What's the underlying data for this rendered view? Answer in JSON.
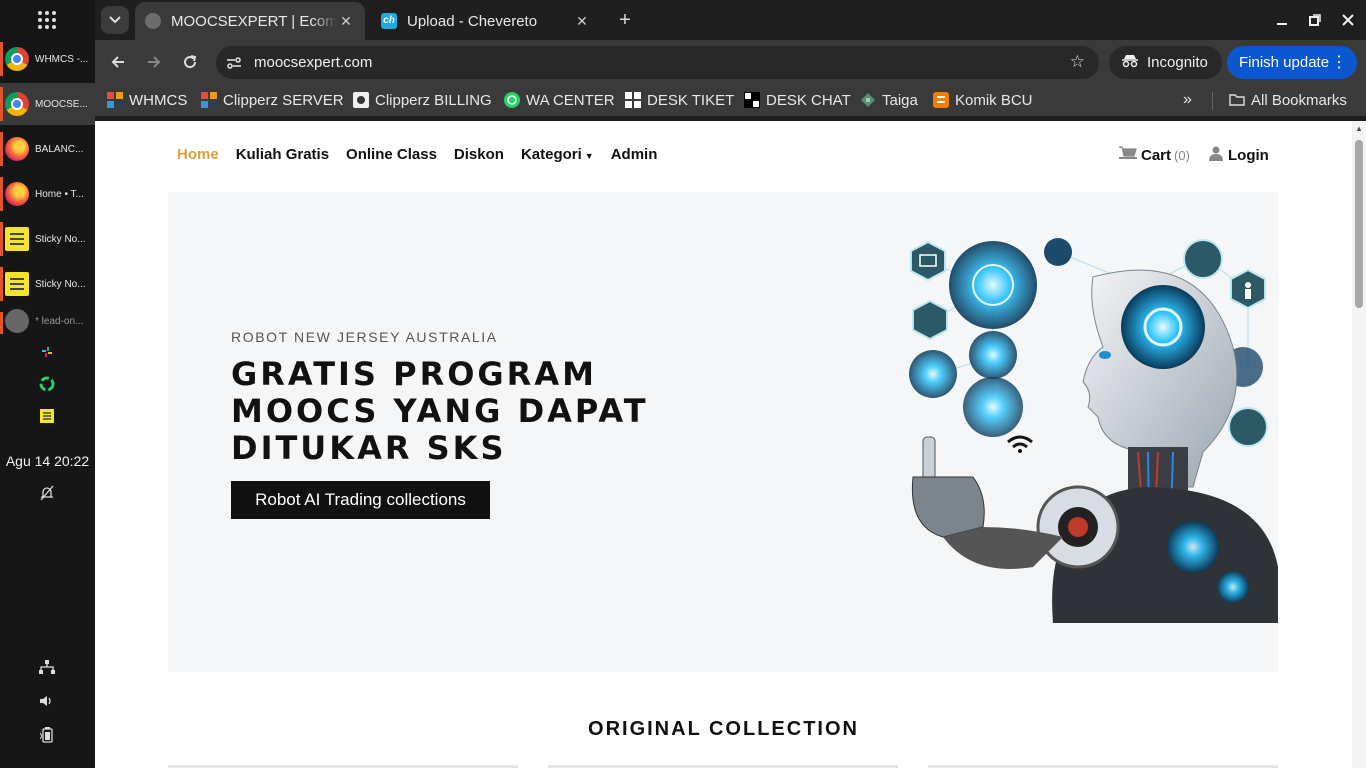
{
  "taskbar": {
    "items": [
      {
        "label": "WHMCS -...",
        "icon": "chrome-icon",
        "active": false
      },
      {
        "label": "MOOCSE...",
        "icon": "chrome-icon",
        "active": true
      },
      {
        "label": "BALANC...",
        "icon": "firefox-icon",
        "active": false
      },
      {
        "label": "Home • T...",
        "icon": "firefox-icon",
        "active": false
      },
      {
        "label": "Sticky No...",
        "icon": "sticky-notes-icon",
        "active": false
      },
      {
        "label": "Sticky No...",
        "icon": "sticky-notes-icon",
        "active": false
      },
      {
        "label": "* lead-on...",
        "icon": "app-icon",
        "active": false
      }
    ],
    "clock": "Agu 14  20:22"
  },
  "browser": {
    "tabs": [
      {
        "title": "MOOCSEXPERT | Ecomm",
        "icon": "globe-icon",
        "active": true
      },
      {
        "title": "Upload - Chevereto",
        "icon": "chevereto-icon",
        "active": false
      }
    ],
    "url": "moocsexpert.com",
    "incognito_label": "Incognito",
    "finish_update_label": "Finish update",
    "bookmarks": [
      {
        "label": "WHMCS",
        "icon": "whmcs-icon"
      },
      {
        "label": "Clipperz SERVER",
        "icon": "whmcs-icon"
      },
      {
        "label": "Clipperz BILLING",
        "icon": "gear-icon"
      },
      {
        "label": "WA CENTER",
        "icon": "whatsapp-icon"
      },
      {
        "label": "DESK TIKET",
        "icon": "desk-icon"
      },
      {
        "label": "DESK CHAT",
        "icon": "desk-icon"
      },
      {
        "label": "Taiga",
        "icon": "taiga-icon"
      },
      {
        "label": "Komik BCU",
        "icon": "blogger-icon"
      }
    ],
    "all_bookmarks_label": "All Bookmarks"
  },
  "site": {
    "nav": [
      {
        "label": "Home",
        "active": true
      },
      {
        "label": "Kuliah Gratis",
        "active": false
      },
      {
        "label": "Online Class",
        "active": false
      },
      {
        "label": "Diskon",
        "active": false
      },
      {
        "label": "Kategori",
        "active": false,
        "dropdown": true
      },
      {
        "label": "Admin",
        "active": false
      }
    ],
    "cart_label": "Cart",
    "cart_count": "(0)",
    "login_label": "Login",
    "hero": {
      "subtitle": "ROBOT NEW JERSEY AUSTRALIA",
      "title": "GRATIS PROGRAM MOOCS YANG DAPAT DITUKAR SKS",
      "button": "Robot AI Trading collections"
    },
    "section_title": "ORIGINAL COLLECTION"
  },
  "colors": {
    "accent": "#d7a43c",
    "update_button": "#0b57d0",
    "taskbar_indicator": "#e2552b"
  }
}
